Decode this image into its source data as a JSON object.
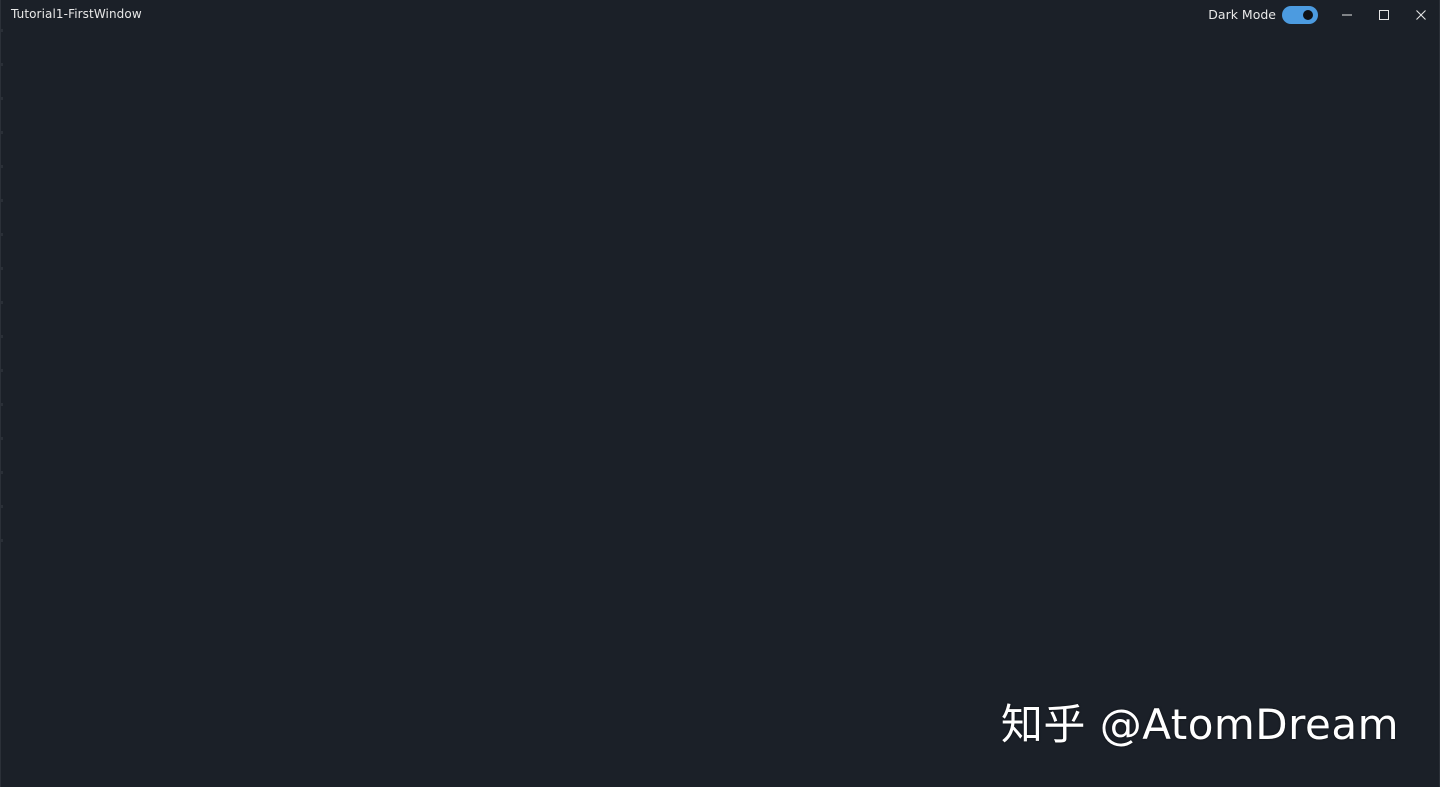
{
  "window": {
    "title": "Tutorial1-FirstWindow",
    "background": "#1b2028"
  },
  "titlebar": {
    "dark_mode_label": "Dark Mode",
    "dark_mode_on": true,
    "toggle_color": "#4c9be0",
    "buttons": {
      "minimize": "minimize-icon",
      "maximize": "maximize-icon",
      "close": "close-icon"
    }
  },
  "watermark": {
    "text": "知乎 @AtomDream"
  }
}
